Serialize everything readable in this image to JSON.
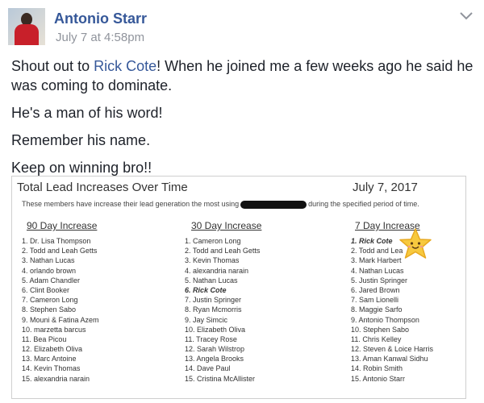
{
  "post": {
    "author": "Antonio Starr",
    "timestamp": "July 7 at 4:58pm",
    "paragraphs": [
      {
        "before": "Shout out to ",
        "link": "Rick Cote",
        "after": "! When he joined me a few weeks ago he said he was coming to dominate."
      },
      {
        "text": "He's a man of his word!"
      },
      {
        "text": "Remember his name."
      },
      {
        "text": "Keep on winning bro!!"
      }
    ]
  },
  "leaderboard": {
    "title": "Total Lead Increases Over Time",
    "date": "July 7, 2017",
    "subtitle_before": "These members have increase their lead generation the most using",
    "subtitle_after": "during the specified period of time.",
    "columns": [
      {
        "heading": "90 Day Increase",
        "rows": [
          "1. Dr. Lisa Thompson",
          "2. Todd and Leah Getts",
          "3. Nathan Lucas",
          "4. orlando brown",
          "5. Adam Chandler",
          "6. Clint Booker",
          "7. Cameron Long",
          "8. Stephen Sabo",
          "9. Mouni & Fatina Azem",
          "10. marzetta barcus",
          "11. Bea Picou",
          "12. Elizabeth Oliva",
          "13. Marc Antoine",
          "14. Kevin Thomas",
          "15. alexandria narain"
        ]
      },
      {
        "heading": "30 Day Increase",
        "rows": [
          "1. Cameron Long",
          "2. Todd and Leah Getts",
          "3. Kevin Thomas",
          "4. alexandria narain",
          "5. Nathan Lucas",
          "6. Rick Cote",
          "7. Justin Springer",
          "8. Ryan Mcmorris",
          "9. Jay Simcic",
          "10. Elizabeth Oliva",
          "11. Tracey Rose",
          "12. Sarah Wilstrop",
          "13. Angela Brooks",
          "14. Dave Paul",
          "15. Cristina McAllister"
        ]
      },
      {
        "heading": "7 Day Increase",
        "rows": [
          "1. Rick Cote",
          "2. Todd and Lea",
          "3. Mark Harbert",
          "4. Nathan Lucas",
          "5. Justin Springer",
          "6. Jared Brown",
          "7. Sam Lionelli",
          "8. Maggie Sarfo",
          "9. Antonio Thompson",
          "10. Stephen Sabo",
          "11. Chris Kelley",
          "12. Steven & Loice Harris",
          "13. Aman Kanwal Sidhu",
          "14. Robin Smith",
          "15. Antonio Starr"
        ]
      }
    ]
  },
  "icons": {
    "options": "chevron-down-icon",
    "sticker": "smiling-star-sticker"
  }
}
